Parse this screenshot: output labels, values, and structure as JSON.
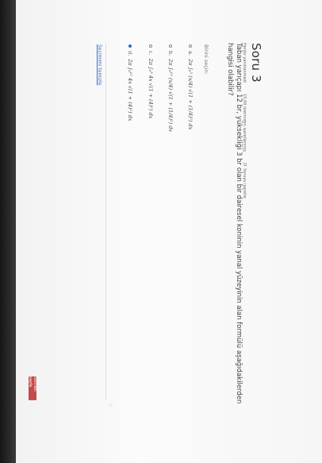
{
  "question": {
    "title": "Soru 3",
    "meta": {
      "status": "Henüz yanıtlanmadı",
      "points": "15,00 üzerinden işaretlenmiş",
      "flag": "Soruyu işaretle"
    },
    "text": "Taban yarıçapı 12 br, yüksekliği 3 br olan bir dairesel koninin yanal yüzeyinin alan formülü aşağıdakilerden hangisi olabilir?",
    "prompt": "Birini seçin:",
    "options": [
      {
        "letter": "a.",
        "formula": "2π ∫₀³ (x/4) √(1 + (1/4)²) dx",
        "checked": false
      },
      {
        "letter": "b.",
        "formula": "2π ∫₀¹² (x/4) √(1 + (1/4)²) dx",
        "checked": false
      },
      {
        "letter": "c.",
        "formula": "2π ∫₀³ 4x √(1 + (4)²) dx",
        "checked": false
      },
      {
        "letter": "d.",
        "formula": "2π ∫₀¹² 4x √(1 + (4)²) dx",
        "checked": true
      }
    ],
    "clear_label": "Seçimimi temizle",
    "next_label": "Sonraki sayfa"
  },
  "colors": {
    "accent": "#2a6cc4",
    "next_button": "#c44a4a"
  }
}
